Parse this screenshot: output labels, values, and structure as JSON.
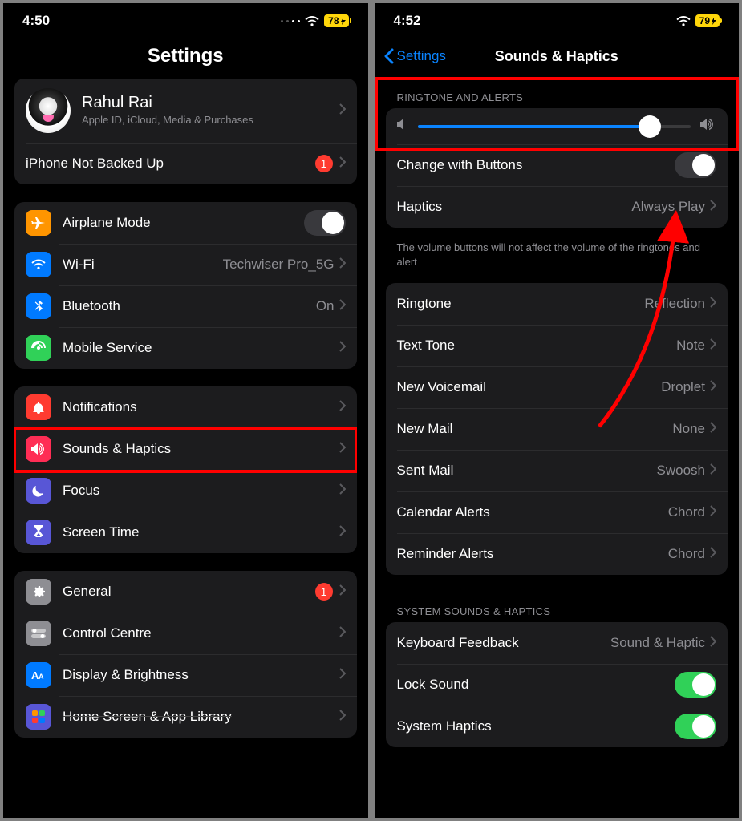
{
  "left": {
    "status": {
      "time": "4:50",
      "battery": "78"
    },
    "title": "Settings",
    "profile": {
      "name": "Rahul Rai",
      "sub": "Apple ID, iCloud, Media & Purchases"
    },
    "backup": {
      "label": "iPhone Not Backed Up",
      "badge": "1"
    },
    "conn": {
      "airplane": "Airplane Mode",
      "wifi": "Wi-Fi",
      "wifi_val": "Techwiser Pro_5G",
      "bt": "Bluetooth",
      "bt_val": "On",
      "mobile": "Mobile Service"
    },
    "notify": {
      "notifications": "Notifications",
      "sounds": "Sounds & Haptics",
      "focus": "Focus",
      "screentime": "Screen Time"
    },
    "general_grp": {
      "general": "General",
      "general_badge": "1",
      "control": "Control Centre",
      "display": "Display & Brightness",
      "home": "Home Screen & App Library"
    }
  },
  "right": {
    "status": {
      "time": "4:52",
      "battery": "79"
    },
    "back": "Settings",
    "title": "Sounds & Haptics",
    "ringtone_header": "RINGTONE AND ALERTS",
    "slider_value": 85,
    "change_buttons": "Change with Buttons",
    "haptics": "Haptics",
    "haptics_val": "Always Play",
    "note": "The volume buttons will not affect the volume of the ringtones and alert",
    "tones": {
      "ringtone": "Ringtone",
      "ringtone_v": "Reflection",
      "text": "Text Tone",
      "text_v": "Note",
      "voicemail": "New Voicemail",
      "voicemail_v": "Droplet",
      "mail": "New Mail",
      "mail_v": "None",
      "sent": "Sent Mail",
      "sent_v": "Swoosh",
      "calendar": "Calendar Alerts",
      "calendar_v": "Chord",
      "reminder": "Reminder Alerts",
      "reminder_v": "Chord"
    },
    "sys_header": "SYSTEM SOUNDS & HAPTICS",
    "sys": {
      "keyboard": "Keyboard Feedback",
      "keyboard_v": "Sound & Haptic",
      "lock": "Lock Sound",
      "syshap": "System Haptics"
    }
  }
}
